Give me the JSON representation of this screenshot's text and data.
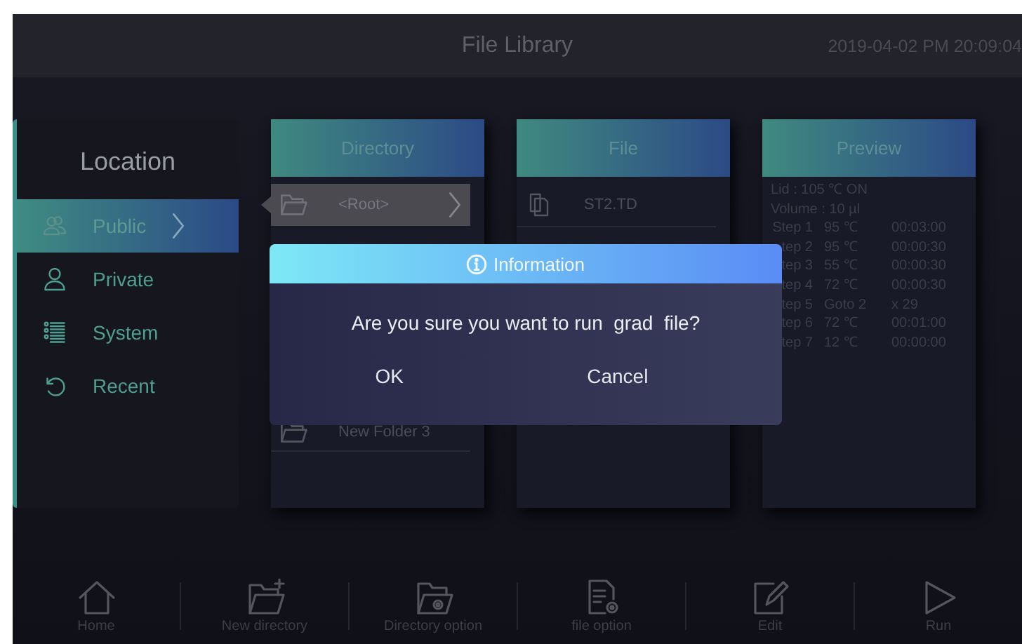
{
  "window": {
    "title": "File Library",
    "datetime": "2019-04-02 PM 20:09:04"
  },
  "sidebar": {
    "title": "Location",
    "items": [
      {
        "label": "Public",
        "selected": true
      },
      {
        "label": "Private",
        "selected": false
      },
      {
        "label": "System",
        "selected": false
      },
      {
        "label": "Recent",
        "selected": false
      }
    ]
  },
  "directory": {
    "title": "Directory",
    "items": [
      {
        "label": "<Root>",
        "selected": true
      },
      {
        "label": "New Folder 3",
        "selected": false
      }
    ]
  },
  "file": {
    "title": "File",
    "items": [
      {
        "label": "ST2.TD",
        "selected": false
      }
    ]
  },
  "preview": {
    "title": "Preview",
    "lines": [
      "Lid : 105 ℃  ON",
      "Volume : 10 µl"
    ],
    "steps": [
      {
        "step": "Step 1",
        "value": "95 ℃",
        "time": "00:03:00"
      },
      {
        "step": "tep 2",
        "value": "95 ℃",
        "time": "00:00:30"
      },
      {
        "step": "tep 3",
        "value": "55 ℃",
        "time": "00:00:30"
      },
      {
        "step": "tep 4",
        "value": "72 ℃",
        "time": "00:00:30"
      },
      {
        "step": "tep 5",
        "value": "Goto 2",
        "time": "x 29"
      },
      {
        "step": "tep 6",
        "value": "72 ℃",
        "time": "00:01:00"
      },
      {
        "step": "tep 7",
        "value": "12 ℃",
        "time": "00:00:00"
      }
    ]
  },
  "dialog": {
    "title": "Information",
    "message": "Are you sure you want to run  grad  file?",
    "buttons": [
      "OK",
      "Cancel"
    ]
  },
  "toolbar": [
    {
      "label": "Home"
    },
    {
      "label": "New directory"
    },
    {
      "label": "Directory option"
    },
    {
      "label": "file option"
    },
    {
      "label": "Edit"
    },
    {
      "label": "Run"
    }
  ]
}
